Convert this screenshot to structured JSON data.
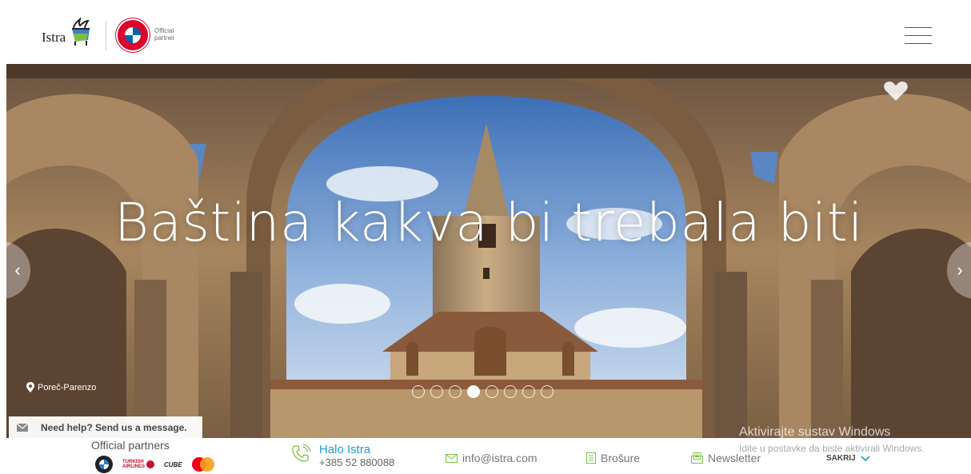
{
  "header": {
    "brand": "Istra",
    "partner_text": "Official partner"
  },
  "hero": {
    "title": "Baština kakva bi trebala biti",
    "location": "Poreč-Parenzo",
    "slides_total": 8,
    "active_slide": 4
  },
  "help": {
    "label": "Need help? Send us a message."
  },
  "footer": {
    "partners_label": "Official partners",
    "partners": [
      "bmw-logo",
      "turkish-airlines-logo",
      "cube-logo",
      "mastercard-logo"
    ],
    "turkish_line1": "TURKISH",
    "turkish_line2": "AIRLINES",
    "cube_text": "CUBE",
    "halo_title": "Halo Istra",
    "halo_phone": "+385 52 880088",
    "email": "info@istra.com",
    "brochures": "Brošure",
    "newsletter": "Newsletter",
    "hide": "SAKRIJ"
  },
  "watermark": {
    "line1": "Aktivirajte sustav Windows",
    "line2": "Idite u postavke da biste aktivirali Windows."
  },
  "colors": {
    "accent": "#1f9bd7",
    "fcb_red": "#dc052d"
  }
}
